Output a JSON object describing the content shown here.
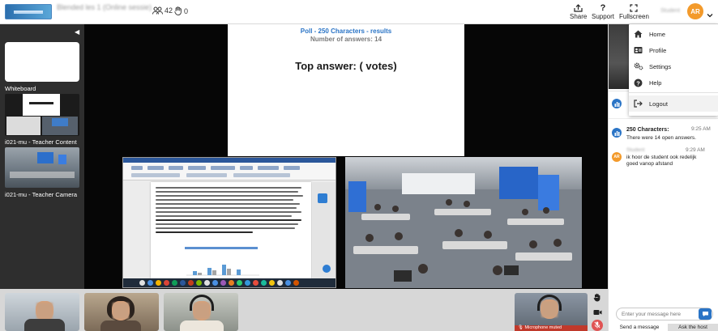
{
  "header": {
    "title": "Blended les 1 (Online sessie)",
    "subtitle": "",
    "participants_count": "42",
    "raised_hands_count": "0",
    "buttons": [
      {
        "label": "Share",
        "icon": "share-icon"
      },
      {
        "label": "Support",
        "icon": "question-icon"
      },
      {
        "label": "Fullscreen",
        "icon": "fullscreen-icon"
      }
    ],
    "user_name": "Student",
    "user_initials": "AR"
  },
  "left_panel": {
    "items": [
      {
        "label": "Whiteboard"
      },
      {
        "label": "i021-mu - Teacher Content"
      },
      {
        "label": "i021-mu - Teacher Camera"
      }
    ]
  },
  "poll": {
    "title": "Poll - 250 Characters - results",
    "count": "Number of answers: 14",
    "top_answer": "Top answer: ( votes)"
  },
  "document": {
    "lines_bold": "stud 120 samen bewegen"
  },
  "user_menu": {
    "items": [
      {
        "label": "Home",
        "icon": "home-icon"
      },
      {
        "label": "Profile",
        "icon": "profile-card-icon"
      },
      {
        "label": "Settings",
        "icon": "settings-icon"
      },
      {
        "label": "Help",
        "icon": "help-icon"
      },
      {
        "label": "Logout",
        "icon": "logout-icon"
      }
    ]
  },
  "chat": {
    "messages": [
      {
        "type": "poll",
        "title": "250 Characters:",
        "time": "9:25 AM",
        "text": "There were 14 open answers."
      },
      {
        "type": "user",
        "author": "Student",
        "time": "9:29 AM",
        "initials": "AR",
        "text": "ik hoor de student ook redelijk goed vanop afstand"
      }
    ],
    "input_placeholder": "Enter your message here",
    "tabs": [
      "Send a message",
      "Ask the host"
    ]
  },
  "participants": {
    "muted_label": "🎙 Microphone muted"
  },
  "colors": {
    "accent": "#2a74c6",
    "avatar": "#f39a2b",
    "muted": "#c0392b"
  }
}
